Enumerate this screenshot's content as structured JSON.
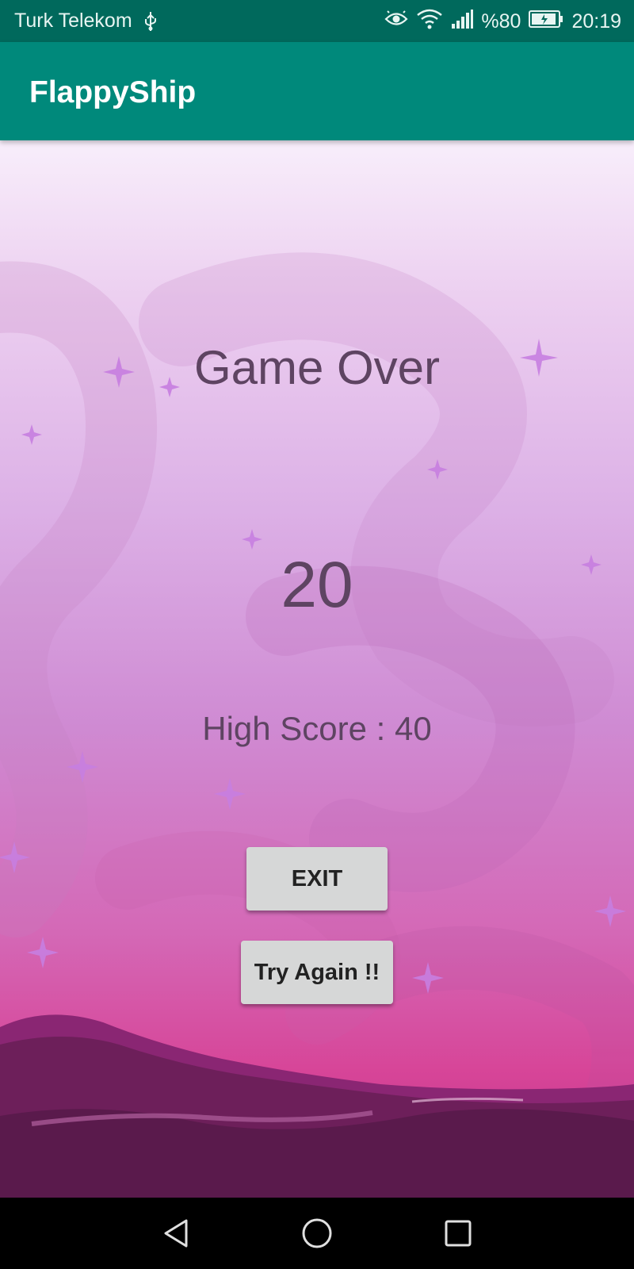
{
  "status_bar": {
    "carrier": "Turk Telekom",
    "battery_percent": "%80",
    "time": "20:19",
    "icons": [
      "usb-icon",
      "eye-comfort-icon",
      "wifi-icon",
      "signal-icon",
      "battery-charging-icon"
    ]
  },
  "app_bar": {
    "title": "FlappyShip",
    "color": "#00897b",
    "status_color": "#00695c"
  },
  "game": {
    "title": "Game Over",
    "score": "20",
    "high_score": "High Score : 40",
    "text_color": "#5e4462"
  },
  "buttons": {
    "exit": "EXIT",
    "try_again": "Try Again !!"
  },
  "nav_bar": {
    "icons": [
      "back-icon",
      "home-icon",
      "recents-icon"
    ]
  }
}
